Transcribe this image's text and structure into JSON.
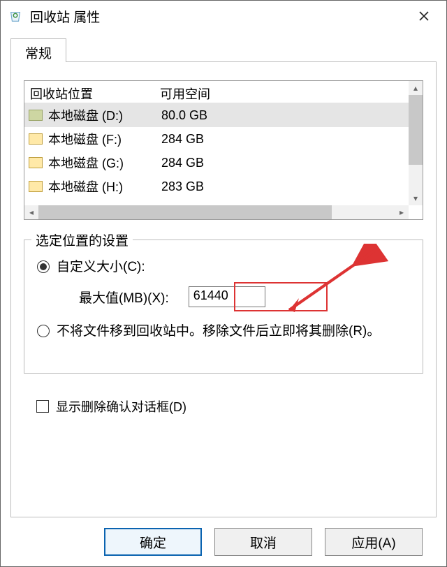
{
  "window": {
    "title": "回收站 属性"
  },
  "tabs": {
    "general": "常规"
  },
  "listview": {
    "columns": {
      "location": "回收站位置",
      "space": "可用空间"
    },
    "rows": [
      {
        "label": "本地磁盘 (D:)",
        "space": "80.0 GB",
        "selected": true
      },
      {
        "label": "本地磁盘 (F:)",
        "space": "284 GB",
        "selected": false
      },
      {
        "label": "本地磁盘 (G:)",
        "space": "284 GB",
        "selected": false
      },
      {
        "label": "本地磁盘 (H:)",
        "space": "283 GB",
        "selected": false
      }
    ]
  },
  "group": {
    "legend": "选定位置的设置",
    "optCustom": "自定义大小(C):",
    "maxLabel": "最大值(MB)(X):",
    "maxValue": "61440",
    "optNoRecycle": "不将文件移到回收站中。移除文件后立即将其删除(R)。"
  },
  "confirmDelete": "显示删除确认对话框(D)",
  "buttons": {
    "ok": "确定",
    "cancel": "取消",
    "apply": "应用(A)"
  }
}
